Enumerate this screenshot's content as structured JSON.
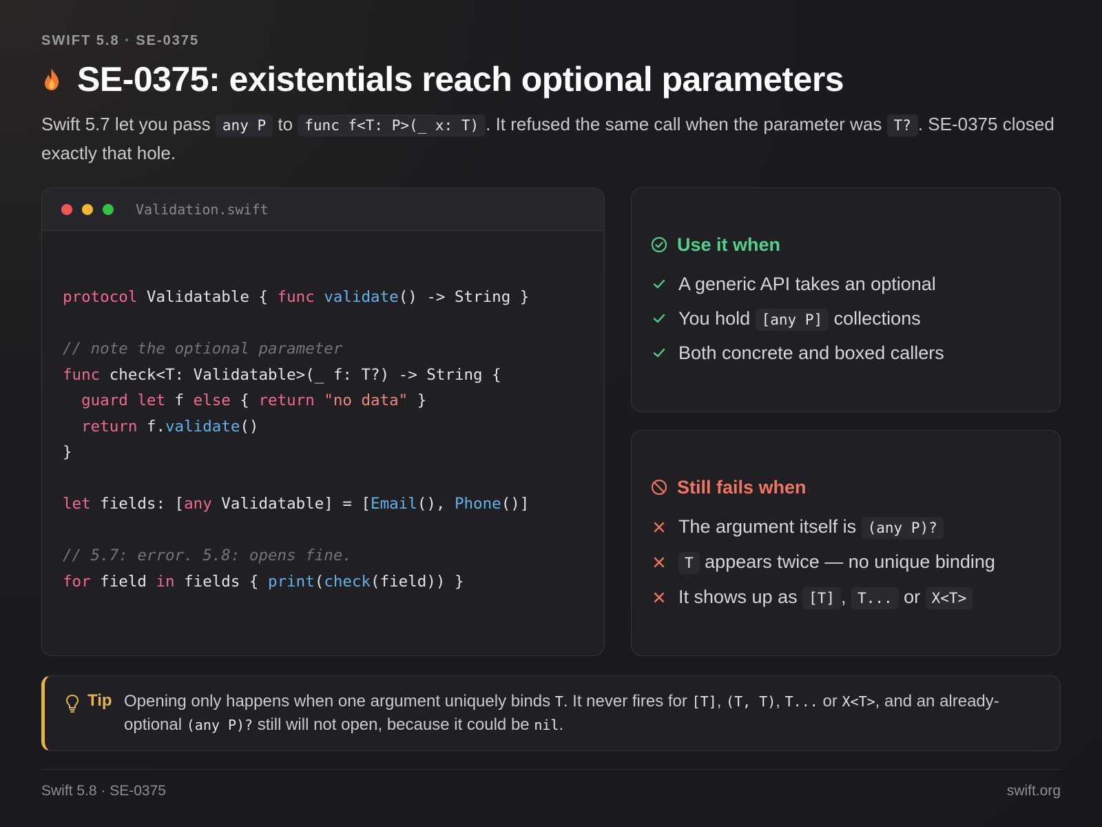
{
  "eyebrow": "SWIFT 5.8 · SE-0375",
  "title": "SE-0375: existentials reach optional parameters",
  "lede": {
    "p1": "Swift 5.7 let you pass ",
    "c1": "any P",
    "p2": " to ",
    "c2": "func f<T: P>(_ x: T)",
    "p3": ". It refused the same call when the parameter was ",
    "c3": "T?",
    "p4": ". SE-0375 closed exactly that hole."
  },
  "code_window": {
    "filename": "Validation.swift",
    "lines": {
      "l1": {
        "a": "protocol",
        "b": " Validatable { ",
        "c": "func",
        "d": " ",
        "e": "validate",
        "f": "() -> String }"
      },
      "l3": "// note the optional parameter",
      "l4": {
        "a": "func",
        "b": " check<T: Validatable>(_ f: T?) -> String {"
      },
      "l5": {
        "ind": "  ",
        "a": "guard",
        "b": " ",
        "c": "let",
        "d": " f ",
        "e": "else",
        "f": " { ",
        "g": "return",
        "h": " ",
        "i": "\"no data\"",
        "j": " }"
      },
      "l6": {
        "ind": "  ",
        "a": "return",
        "b": " f.",
        "c": "validate",
        "d": "()"
      },
      "l7": "}",
      "l9": {
        "a": "let",
        "b": " fields: [",
        "c": "any",
        "d": " Validatable] = [",
        "e": "Email",
        "f": "(), ",
        "g": "Phone",
        "h": "()]"
      },
      "l11": "// 5.7: error. 5.8: opens fine.",
      "l12": {
        "a": "for",
        "b": " field ",
        "c": "in",
        "d": " fields { ",
        "e": "print",
        "f": "(",
        "g": "check",
        "h": "(field)) }"
      }
    }
  },
  "use_card": {
    "heading": "Use it when",
    "items": {
      "i1": "A generic API takes an optional",
      "i2_pre": "You hold ",
      "i2_code": "[any P]",
      "i2_post": " collections",
      "i3": "Both concrete and boxed callers"
    }
  },
  "fail_card": {
    "heading": "Still fails when",
    "items": {
      "i1_pre": "The argument itself is ",
      "i1_code": "(any P)?",
      "i2_code": "T",
      "i2_post": " appears twice — no unique binding",
      "i3_pre": "It shows up as ",
      "i3_c1": "[T]",
      "i3_sep1": ", ",
      "i3_c2": "T...",
      "i3_sep2": " or ",
      "i3_c3": "X<T>"
    }
  },
  "tip": {
    "label": "Tip",
    "t1": "Opening only happens when one argument uniquely binds ",
    "m1": "T",
    "t2": ". It never fires for ",
    "m2": "[T]",
    "t3": ", ",
    "m3": "(T, T)",
    "t4": ", ",
    "m4": "T...",
    "t5": " or ",
    "m5": "X<T>",
    "t6": ", and an already-optional ",
    "m6": "(any P)?",
    "t7": " still will not open, because it could be ",
    "m7": "nil",
    "t8": "."
  },
  "footer": {
    "left": "Swift 5.8 · SE-0375",
    "right": "swift.org"
  },
  "colors": {
    "accent_green": "#52d18a",
    "accent_red": "#f07564",
    "tip_gold": "#e5b54a",
    "keyword_pink": "#f26a8c",
    "function_blue": "#64b2e6"
  }
}
